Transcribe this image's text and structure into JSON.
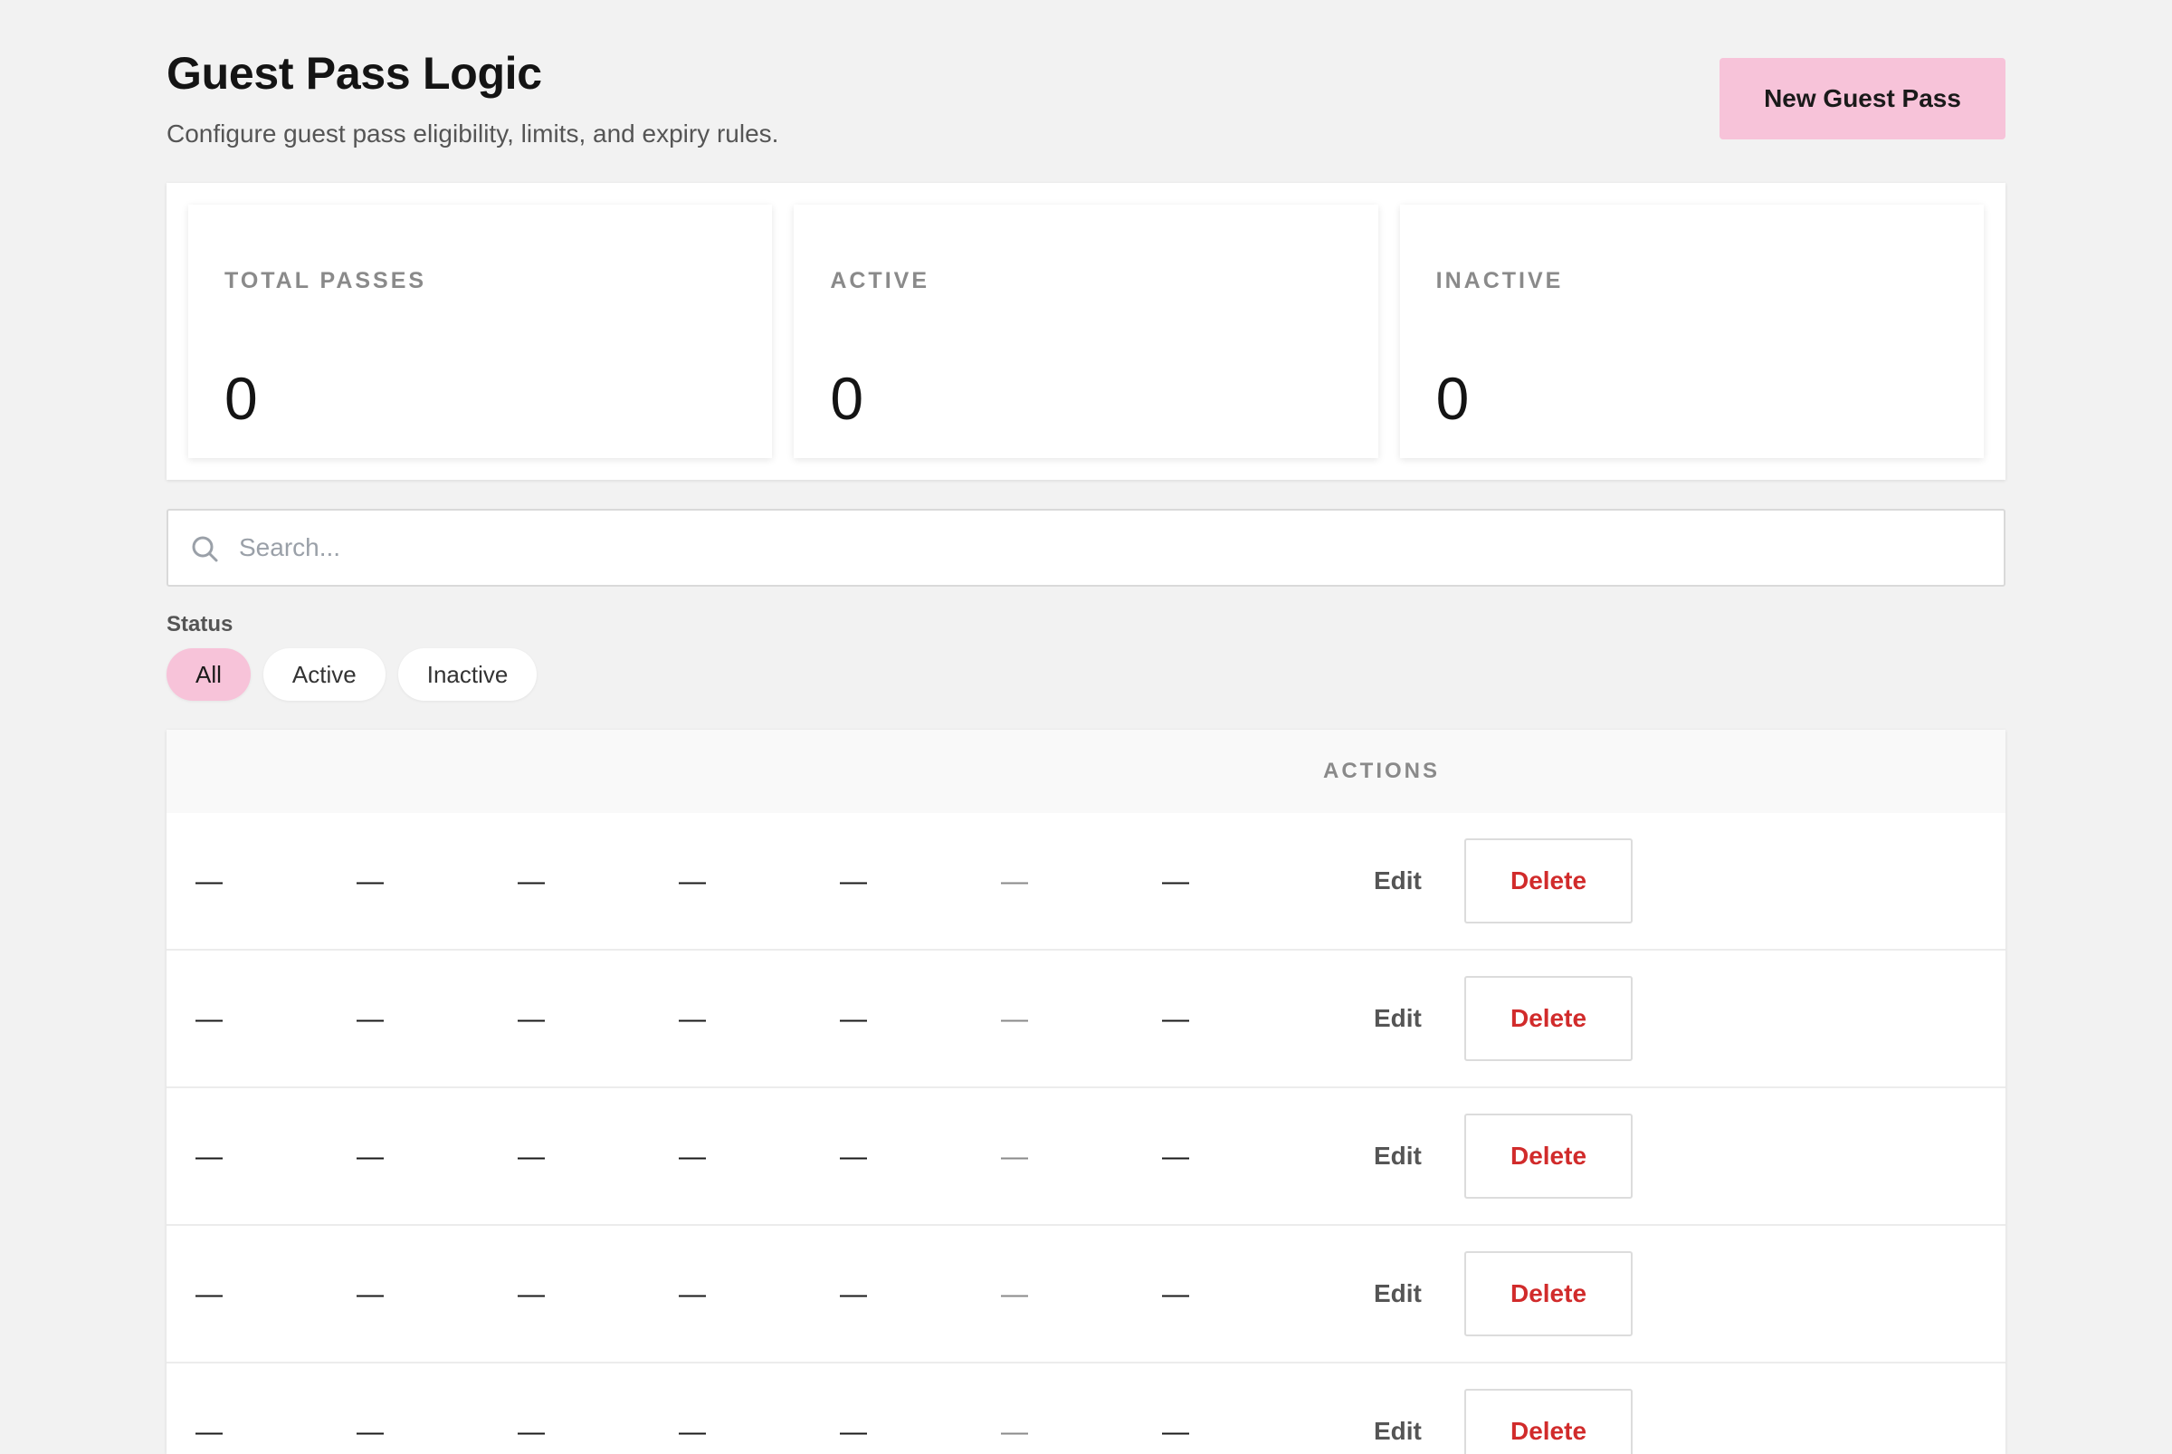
{
  "header": {
    "title": "Guest Pass Logic",
    "subtitle": "Configure guest pass eligibility, limits, and expiry rules.",
    "new_button_label": "New Guest Pass"
  },
  "stats": [
    {
      "label": "TOTAL PASSES",
      "value": "0"
    },
    {
      "label": "ACTIVE",
      "value": "0"
    },
    {
      "label": "INACTIVE",
      "value": "0"
    }
  ],
  "search": {
    "placeholder": "Search...",
    "value": "",
    "icon": "search-icon"
  },
  "filter": {
    "label": "Status",
    "options": [
      "All",
      "Active",
      "Inactive"
    ],
    "selected": "All"
  },
  "table": {
    "actions_header": "ACTIONS",
    "rows": [
      {
        "cells": [
          "—",
          "—",
          "—",
          "—",
          "—",
          "—",
          "—"
        ],
        "edit_label": "Edit",
        "delete_label": "Delete"
      },
      {
        "cells": [
          "—",
          "—",
          "—",
          "—",
          "—",
          "—",
          "—"
        ],
        "edit_label": "Edit",
        "delete_label": "Delete"
      },
      {
        "cells": [
          "—",
          "—",
          "—",
          "—",
          "—",
          "—",
          "—"
        ],
        "edit_label": "Edit",
        "delete_label": "Delete"
      },
      {
        "cells": [
          "—",
          "—",
          "—",
          "—",
          "—",
          "—",
          "—"
        ],
        "edit_label": "Edit",
        "delete_label": "Delete"
      },
      {
        "cells": [
          "—",
          "—",
          "—",
          "—",
          "—",
          "—",
          "—"
        ],
        "edit_label": "Edit",
        "delete_label": "Delete"
      }
    ]
  },
  "colors": {
    "accent": "#f7c3d9",
    "danger": "#d12b2b",
    "background": "#f2f2f2"
  }
}
